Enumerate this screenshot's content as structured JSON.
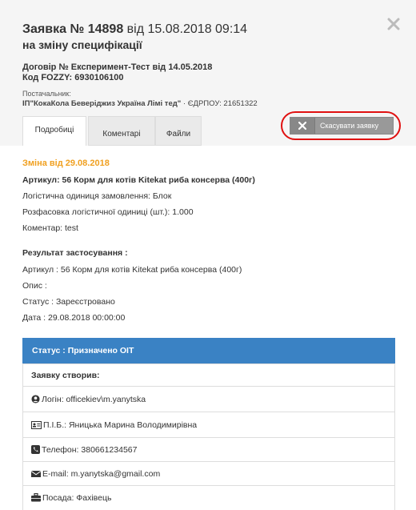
{
  "header": {
    "title_prefix": "Заявка № 14898",
    "title_suffix": "від 15.08.2018 09:14",
    "subtitle": "на зміну специфікації",
    "contract": "Договір № Експеримент-Тест від 14.05.2018",
    "fozzy_code": "Код FOZZY: 6930106100",
    "supplier_label": "Постачальник:",
    "supplier_name": "ІП\"КокаКола Беверіджиз Україна Лімі тед\"",
    "supplier_edrpou": "· ЄДРПОУ: 21651322"
  },
  "tabs": [
    {
      "label": "Подробиці"
    },
    {
      "label": "Коментарі"
    },
    {
      "label": "Файли"
    }
  ],
  "actions": {
    "cancel_label": "Скасувати заявку"
  },
  "details": {
    "change_date": "Зміна від 29.08.2018",
    "article": "Артикул: 56 Корм для котів Kitekat риба консерва (400г)",
    "logistic_unit": "Логістична одиниця замовлення: Блок",
    "packaging": "Розфасовка логістичної одиниці (шт.): 1.000",
    "comment": "Коментар: test",
    "result_title": "Результат застосування :",
    "result_article": "Артикул : 56 Корм для котів Kitekat риба консерва (400г)",
    "result_description": "Опис :",
    "result_status": "Статус : Зареєстровано",
    "result_date": "Дата : 29.08.2018 00:00:00"
  },
  "status_panel": {
    "heading": "Статус : Призначено ОІТ",
    "created_by": "Заявку створив:",
    "login": "Логін: officekiev\\m.yanytska",
    "full_name": "П.І.Б.: Яницька Марина Володимирівна",
    "phone": "Телефон: 380661234567",
    "email": "E-mail: m.yanytska@gmail.com",
    "position": "Посада: Фахівець"
  },
  "colors": {
    "accent_orange": "#f0a020",
    "status_blue": "#3a82c4",
    "highlight_red": "#e01010"
  }
}
